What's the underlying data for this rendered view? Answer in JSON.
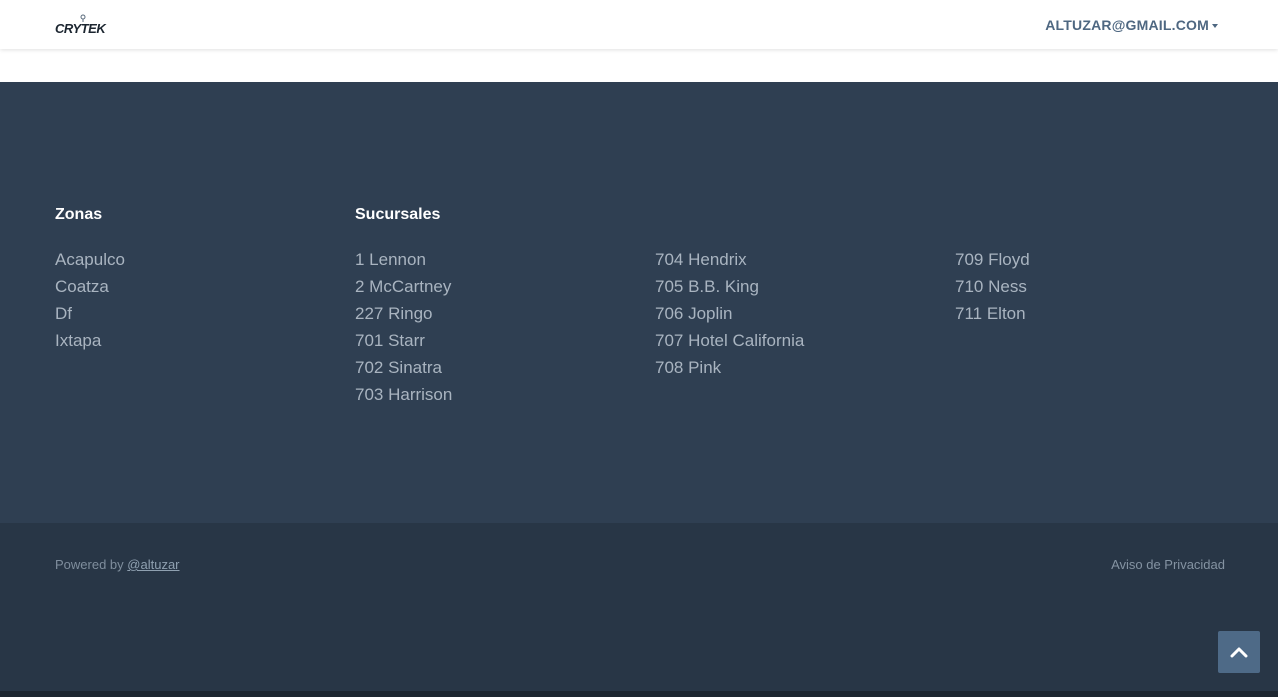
{
  "navbar": {
    "logo_icon": "crytek-logo",
    "logo_text": "CRYTEK",
    "user_email": "ALTUZAR@GMAIL.COM"
  },
  "footer": {
    "zonas": {
      "title": "Zonas",
      "items": [
        "Acapulco",
        "Coatza",
        "Df",
        "Ixtapa"
      ]
    },
    "sucursales": {
      "title": "Sucursales",
      "columns": [
        [
          "1 Lennon",
          "2 McCartney",
          "227 Ringo",
          "701 Starr",
          "702 Sinatra",
          "703 Harrison"
        ],
        [
          "704 Hendrix",
          "705 B.B. King",
          "706 Joplin",
          "707 Hotel California",
          "708 Pink"
        ],
        [
          "709 Floyd",
          "710 Ness",
          "711 Elton"
        ]
      ]
    },
    "bottom": {
      "powered_prefix": "Powered by",
      "powered_link": "@altuzar",
      "privacy": "Aviso de Privacidad"
    }
  },
  "back_to_top_icon": "chevron-up-icon",
  "colors": {
    "navbar_bg": "#ffffff",
    "footer_bg": "#2f3f52",
    "footer_bottom_bg": "#283646",
    "accent": "#4e6781",
    "link_text": "#a9b4c0"
  }
}
